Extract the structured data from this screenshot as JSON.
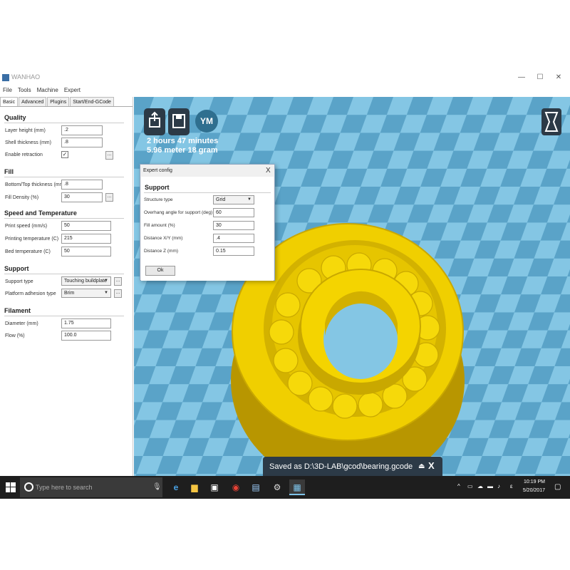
{
  "window": {
    "title": "WANHAO",
    "minimize": "—",
    "maximize": "☐",
    "close": "✕"
  },
  "menu": [
    "File",
    "Tools",
    "Machine",
    "Expert"
  ],
  "tabs": [
    "Basic",
    "Advanced",
    "Plugins",
    "Start/End-GCode"
  ],
  "settings": {
    "quality": {
      "title": "Quality",
      "layer_height_label": "Layer height (mm)",
      "layer_height": ".2",
      "shell_thickness_label": "Shell thickness (mm)",
      "shell_thickness": ".8",
      "enable_retraction_label": "Enable retraction",
      "enable_retraction": "✓"
    },
    "fill": {
      "title": "Fill",
      "bottom_top_label": "Bottom/Top thickness (mm)",
      "bottom_top": ".8",
      "fill_density_label": "Fill Density (%)",
      "fill_density": "30"
    },
    "speed": {
      "title": "Speed and Temperature",
      "print_speed_label": "Print speed (mm/s)",
      "print_speed": "50",
      "printing_temp_label": "Printing temperature (C)",
      "printing_temp": "215",
      "bed_temp_label": "Bed temperature (C)",
      "bed_temp": "50"
    },
    "support": {
      "title": "Support",
      "support_type_label": "Support type",
      "support_type": "Touching buildplate",
      "adhesion_label": "Platform adhesion type",
      "adhesion": "Brim"
    },
    "filament": {
      "title": "Filament",
      "diameter_label": "Diameter (mm)",
      "diameter": "1.75",
      "flow_label": "Flow (%)",
      "flow": "100.0"
    },
    "dots_label": "..."
  },
  "viewport": {
    "print_time": "2 hours 47 minutes",
    "material": "5.96 meter 18 gram",
    "ym_label": "YM",
    "colors": {
      "background": "#6ab6d8",
      "checker_dark": "#5aa3c8",
      "checker_light": "#84c6e4",
      "model": "#f2d100",
      "model_shade": "#c9a800",
      "toolbar": "#2c3a47"
    }
  },
  "dialog": {
    "title": "Expert config",
    "close": "X",
    "section": "Support",
    "structure_type_label": "Structure type",
    "structure_type": "Grid",
    "overhang_label": "Overhang angle for support (deg)",
    "overhang": "60",
    "fill_amount_label": "Fill amount (%)",
    "fill_amount": "30",
    "distance_xy_label": "Distance X/Y (mm)",
    "distance_xy": ".4",
    "distance_z_label": "Distance Z (mm)",
    "distance_z": "0.15",
    "ok_label": "Ok"
  },
  "toast": {
    "text": "Saved as D:\\3D-LAB\\gcod\\bearing.gcode",
    "eject": "⏏",
    "close": "X"
  },
  "taskbar": {
    "search_placeholder": "Type here to search",
    "time": "10:19 PM",
    "date": "5/20/2017"
  }
}
